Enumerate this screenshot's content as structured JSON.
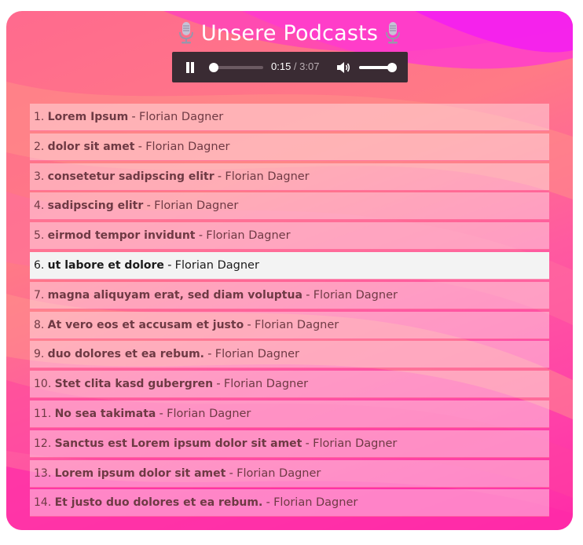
{
  "header": {
    "title": "Unsere Podcasts",
    "icon": "microphone-icon"
  },
  "player": {
    "state": "playing",
    "current_time": "0:15",
    "separator": " / ",
    "duration": "3:07",
    "progress_fraction": 0.08,
    "volume_fraction": 1.0
  },
  "playlist": {
    "separator": " - ",
    "active_index": 5,
    "items": [
      {
        "number": "1.",
        "title": "Lorem Ipsum",
        "author": "Florian Dagner"
      },
      {
        "number": "2.",
        "title": "dolor sit amet",
        "author": "Florian Dagner"
      },
      {
        "number": "3.",
        "title": "consetetur sadipscing elitr",
        "author": "Florian Dagner"
      },
      {
        "number": "4.",
        "title": "sadipscing elitr",
        "author": "Florian Dagner"
      },
      {
        "number": "5.",
        "title": "eirmod tempor invidunt",
        "author": "Florian Dagner"
      },
      {
        "number": "6.",
        "title": "ut labore et dolore",
        "author": "Florian Dagner"
      },
      {
        "number": "7.",
        "title": "magna aliquyam erat, sed diam voluptua",
        "author": "Florian Dagner"
      },
      {
        "number": "8.",
        "title": "At vero eos et accusam et justo",
        "author": "Florian Dagner"
      },
      {
        "number": "9.",
        "title": "duo dolores et ea rebum.",
        "author": "Florian Dagner"
      },
      {
        "number": "10.",
        "title": "Stet clita kasd gubergren",
        "author": "Florian Dagner"
      },
      {
        "number": "11.",
        "title": "No sea takimata",
        "author": "Florian Dagner"
      },
      {
        "number": "12.",
        "title": "Sanctus est Lorem ipsum dolor sit amet",
        "author": "Florian Dagner"
      },
      {
        "number": "13.",
        "title": "Lorem ipsum dolor sit amet",
        "author": "Florian Dagner"
      },
      {
        "number": "14.",
        "title": "Et justo duo dolores et ea rebum.",
        "author": "Florian Dagner"
      }
    ]
  },
  "colors": {
    "background_pink": "#ff5aa0",
    "background_coral": "#ff7a86",
    "background_magenta": "#ff2aa8",
    "player_bg": "#3a2b33",
    "seek_accent": "#1fa1e8",
    "active_row": "#f3f3f3"
  }
}
